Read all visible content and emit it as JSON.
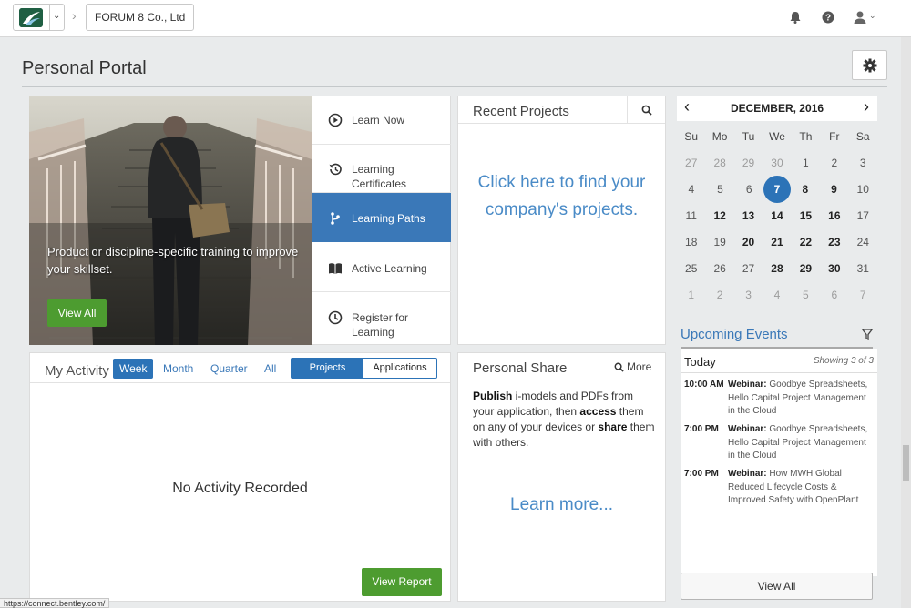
{
  "topbar": {
    "org_name": "FORUM 8 Co., Ltd",
    "notifications_icon": "bell-icon",
    "help_icon": "question-circle-icon",
    "user_icon": "user-icon"
  },
  "page": {
    "title": "Personal Portal"
  },
  "learning": {
    "hero_text": "Product or discipline-specific training to improve your skillset.",
    "view_all_label": "View All",
    "menu": [
      {
        "label": "Learn Now",
        "icon": "play-circle-icon"
      },
      {
        "label": "Learning Certificates",
        "icon": "history-icon"
      },
      {
        "label": "Learning Paths",
        "icon": "path-branch-icon"
      },
      {
        "label": "Active Learning",
        "icon": "book-icon"
      },
      {
        "label": "Register for Learning",
        "icon": "clock-icon"
      }
    ]
  },
  "recent_projects": {
    "title": "Recent Projects",
    "link_text": "Click here to find your company's projects."
  },
  "calendar": {
    "month_label": "DECEMBER, 2016",
    "weekdays": [
      "Su",
      "Mo",
      "Tu",
      "We",
      "Th",
      "Fr",
      "Sa"
    ],
    "today": "7",
    "weeks": [
      [
        [
          "27",
          "out"
        ],
        [
          "28",
          "out"
        ],
        [
          "29",
          "out"
        ],
        [
          "30",
          "out"
        ],
        [
          "1",
          "in"
        ],
        [
          "2",
          "in"
        ],
        [
          "3",
          "in"
        ]
      ],
      [
        [
          "4",
          "in"
        ],
        [
          "5",
          "in"
        ],
        [
          "6",
          "in"
        ],
        [
          "7",
          "today"
        ],
        [
          "8",
          "bold"
        ],
        [
          "9",
          "bold"
        ],
        [
          "10",
          "in"
        ]
      ],
      [
        [
          "11",
          "in"
        ],
        [
          "12",
          "bold"
        ],
        [
          "13",
          "bold"
        ],
        [
          "14",
          "bold"
        ],
        [
          "15",
          "bold"
        ],
        [
          "16",
          "bold"
        ],
        [
          "17",
          "in"
        ]
      ],
      [
        [
          "18",
          "in"
        ],
        [
          "19",
          "in"
        ],
        [
          "20",
          "bold"
        ],
        [
          "21",
          "bold"
        ],
        [
          "22",
          "bold"
        ],
        [
          "23",
          "bold"
        ],
        [
          "24",
          "in"
        ]
      ],
      [
        [
          "25",
          "in"
        ],
        [
          "26",
          "in"
        ],
        [
          "27",
          "in"
        ],
        [
          "28",
          "bold"
        ],
        [
          "29",
          "bold"
        ],
        [
          "30",
          "bold"
        ],
        [
          "31",
          "in"
        ]
      ],
      [
        [
          "1",
          "out"
        ],
        [
          "2",
          "out"
        ],
        [
          "3",
          "out"
        ],
        [
          "4",
          "out"
        ],
        [
          "5",
          "out"
        ],
        [
          "6",
          "out"
        ],
        [
          "7",
          "out"
        ]
      ]
    ]
  },
  "events": {
    "title": "Upcoming Events",
    "day_label": "Today",
    "showing": "Showing 3 of 3",
    "items": [
      {
        "time": "10:00 AM",
        "kind": "Webinar:",
        "text": " Goodbye Spreadsheets, Hello Capital Project Management in the Cloud"
      },
      {
        "time": "7:00 PM",
        "kind": "Webinar:",
        "text": " Goodbye Spreadsheets, Hello Capital Project Management in the Cloud"
      },
      {
        "time": "7:00 PM",
        "kind": "Webinar:",
        "text": " How MWH Global Reduced Lifecycle Costs & Improved Safety with OpenPlant"
      }
    ],
    "view_all_label": "View All"
  },
  "activity": {
    "title": "My Activity",
    "tabs": [
      "Week",
      "Month",
      "Quarter",
      "All"
    ],
    "active_tab": "Week",
    "segments": [
      "Projects",
      "Applications"
    ],
    "active_segment": "Projects",
    "empty_text": "No Activity Recorded",
    "view_report_label": "View Report"
  },
  "personal_share": {
    "title": "Personal Share",
    "more_label": "More",
    "desc_1": "Publish",
    "desc_2": " i-models and PDFs from your application, then ",
    "desc_3": "access",
    "desc_4": " them on any of your devices or ",
    "desc_5": "share",
    "desc_6": " them with others.",
    "link_text": "Learn more..."
  },
  "status_url": "https://connect.bentley.com/",
  "colors": {
    "accent_blue": "#2c73b7",
    "link_blue": "#4a8bc7",
    "active_menu": "#3a78b8",
    "action_green": "#4d9c30",
    "page_bg": "#e9ebec"
  }
}
